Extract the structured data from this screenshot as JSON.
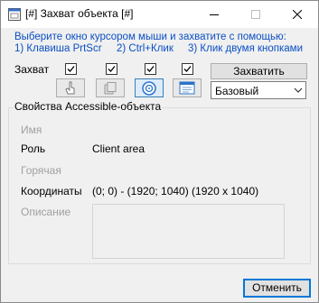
{
  "window": {
    "title": "[#] Захват объекта [#]"
  },
  "instructions": {
    "line1": "Выберите окно курсором мыши и захватите с помощью:",
    "option1": "1) Клавиша PrtScr",
    "option2": "2) Ctrl+Клик",
    "option3": "3) Клик двумя кнопками"
  },
  "capture": {
    "label": "Захват",
    "checkboxes": [
      true,
      true,
      true,
      true
    ],
    "tools": [
      {
        "icon": "finger-pointer-icon",
        "active": false
      },
      {
        "icon": "window-copy-icon",
        "active": false
      },
      {
        "icon": "target-icon",
        "active": true
      },
      {
        "icon": "window-list-icon",
        "active": false
      }
    ],
    "button_label": "Захватить",
    "mode": "Базовый"
  },
  "properties": {
    "group_title": "Свойства Accessible-объекта",
    "name_label": "Имя",
    "name_value": "",
    "role_label": "Роль",
    "role_value": "Client area",
    "hotkey_label": "Горячая",
    "hotkey_value": "",
    "coords_label": "Координаты",
    "coords_value": "(0; 0) - (1920; 1040) (1920 x 1040)",
    "desc_label": "Описание",
    "desc_value": ""
  },
  "footer": {
    "cancel_label": "Отменить"
  },
  "colors": {
    "instruction_text": "#0a4fc4",
    "focus_border": "#0078d7"
  }
}
